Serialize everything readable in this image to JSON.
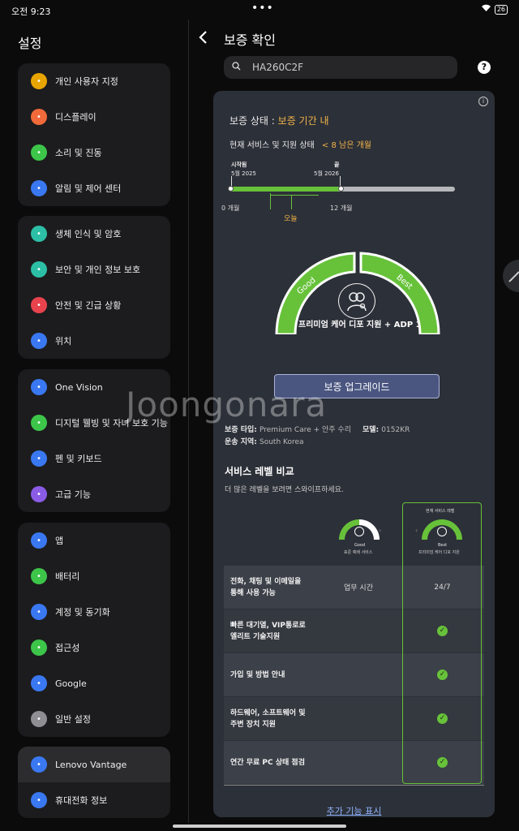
{
  "status_bar": {
    "time": "오전 9:23",
    "battery": "26"
  },
  "settings": {
    "title": "설정",
    "groups": [
      [
        {
          "label": "개인 사용자 지정",
          "icon": "paint-icon",
          "color": "#e8a500"
        },
        {
          "label": "디스플레이",
          "icon": "display-icon",
          "color": "#f06a3a"
        },
        {
          "label": "소리 및 진동",
          "icon": "sound-icon",
          "color": "#3dc54a"
        },
        {
          "label": "알림 및 제어 센터",
          "icon": "notification-icon",
          "color": "#3a78f2"
        }
      ],
      [
        {
          "label": "생체 인식 및 암호",
          "icon": "lock-icon",
          "color": "#2cbfa6"
        },
        {
          "label": "보안 및 개인 정보 보호",
          "icon": "shield-icon",
          "color": "#2cbfa6"
        },
        {
          "label": "안전 및 긴급 상황",
          "icon": "emergency-icon",
          "color": "#e8434d"
        },
        {
          "label": "위치",
          "icon": "location-icon",
          "color": "#3a78f2"
        }
      ],
      [
        {
          "label": "One Vision",
          "icon": "one-vision-icon",
          "color": "#3a78f2"
        },
        {
          "label": "디지털 웰빙 및 자녀 보호 기능",
          "icon": "wellbeing-icon",
          "color": "#3dc54a"
        },
        {
          "label": "펜 및 키보드",
          "icon": "pen-icon",
          "color": "#3a78f2"
        },
        {
          "label": "고급 기능",
          "icon": "advanced-icon",
          "color": "#8a5ce6"
        }
      ],
      [
        {
          "label": "앱",
          "icon": "apps-icon",
          "color": "#3a78f2"
        },
        {
          "label": "배터리",
          "icon": "battery-icon",
          "color": "#3dc54a"
        },
        {
          "label": "계정 및 동기화",
          "icon": "account-icon",
          "color": "#3a78f2"
        },
        {
          "label": "접근성",
          "icon": "accessibility-icon",
          "color": "#3dc54a"
        },
        {
          "label": "Google",
          "icon": "google-icon",
          "color": "#3a78f2"
        },
        {
          "label": "일반 설정",
          "icon": "gear-icon",
          "color": "#8e8e93"
        }
      ],
      [
        {
          "label": "Lenovo Vantage",
          "icon": "vantage-icon",
          "color": "#3a78f2"
        },
        {
          "label": "휴대전화 정보",
          "icon": "phone-info-icon",
          "color": "#3a78f2"
        }
      ]
    ]
  },
  "page": {
    "title": "보증 확인",
    "search_value": "HA260C2F"
  },
  "warranty": {
    "status_label": "보증 상태 : ",
    "status_value": "보증 기간 내",
    "service_label": "현재 서비스 및 지원 상태",
    "remaining": "< 8 남은 개월",
    "start_label": "시작됨",
    "start_date": "5월 2025",
    "end_label": "끝",
    "end_date": "5월 2026",
    "axis_start": "0 개월",
    "axis_end": "12 개월",
    "today": "오늘",
    "progress_fraction": 0.49,
    "gauge_good": "Good",
    "gauge_best": "Best",
    "plan_name": "프리미엄 케어 디포 지원 + ADP 1",
    "upgrade_label": "보증 업그레이드",
    "type_label": "보증 타입: ",
    "type_value": "Premium Care + 안주 수리",
    "model_label": "모델: ",
    "model_value": "0152KR",
    "region_label": "운송 지역: ",
    "region_value": "South Korea"
  },
  "compare": {
    "title": "서비스 레벨 비교",
    "subtitle": "더 많은 레벨을 보려면 스와이프하세요.",
    "current_badge": "현재 서비스 레벨",
    "good_name": "Good",
    "good_desc": "표준 예배 서비스",
    "best_name": "Best",
    "best_desc": "프리미엄 케어 디포 지원",
    "rows": [
      {
        "feature": "전화, 채팅 및 이메일을 통해 사용 가능",
        "good": "업무 시간",
        "best": "24/7"
      },
      {
        "feature": "빠른 대기열, VIP통로로 엘리트 기술지원",
        "good": "",
        "best": "check"
      },
      {
        "feature": "가입 및 방법 안내",
        "good": "",
        "best": "check"
      },
      {
        "feature": "하드웨어, 소프트웨어 및 주변 장치 지원",
        "good": "",
        "best": "check"
      },
      {
        "feature": "연간 무료 PC 상태 점검",
        "good": "",
        "best": "check"
      }
    ],
    "more_label": "추가 기능 표시"
  },
  "watermark": "Joongonara"
}
